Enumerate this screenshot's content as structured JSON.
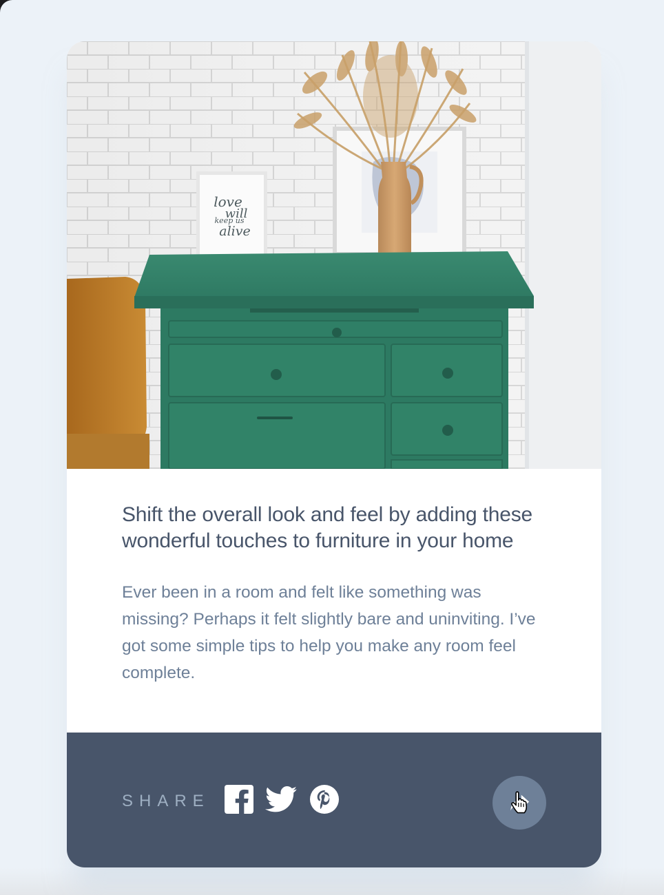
{
  "article": {
    "title": "Shift the overall look and feel by adding these wonderful touches to furniture in your home",
    "description": "Ever been in a room and felt like something was missing? Perhaps it felt slightly bare and uninviting. I’ve got some simple tips to help you make any room feel complete.",
    "image": {
      "alt": "Green dresser with framed art and a vase of dried pampas grass",
      "frame_text": [
        "love",
        "will",
        "keep us",
        "alive"
      ]
    }
  },
  "share": {
    "label": "SHARE",
    "links": [
      {
        "name": "facebook",
        "icon": "facebook-icon"
      },
      {
        "name": "twitter",
        "icon": "twitter-icon"
      },
      {
        "name": "pinterest",
        "icon": "pinterest-icon"
      }
    ],
    "button_icon": "share-arrow-icon",
    "cursor_icon": "hand-pointer-icon"
  },
  "colors": {
    "page_bg": "#ecf2f8",
    "card_bg": "#ffffff",
    "title": "#48556a",
    "body": "#6e8098",
    "footer_bg": "#48556a",
    "share_label": "#9eafc2",
    "share_button": "#6e8098",
    "dresser_green": "#2f7a63"
  }
}
